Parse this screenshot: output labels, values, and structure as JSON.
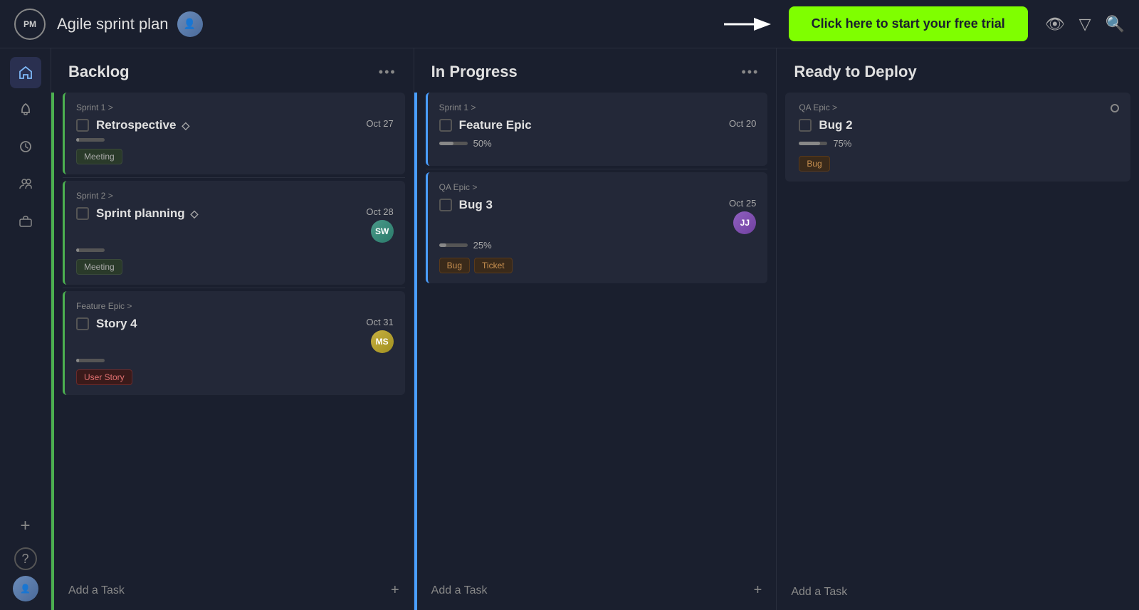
{
  "header": {
    "logo": "PM",
    "title": "Agile sprint plan",
    "free_trial_cta": "Click here to start your free trial"
  },
  "sidebar": {
    "items": [
      {
        "name": "home",
        "icon": "⌂",
        "active": true
      },
      {
        "name": "notifications",
        "icon": "🔔",
        "active": false
      },
      {
        "name": "history",
        "icon": "🕐",
        "active": false
      },
      {
        "name": "team",
        "icon": "👥",
        "active": false
      },
      {
        "name": "briefcase",
        "icon": "💼",
        "active": false
      }
    ],
    "bottom": [
      {
        "name": "add",
        "icon": "+"
      },
      {
        "name": "help",
        "icon": "?"
      }
    ]
  },
  "columns": [
    {
      "id": "backlog",
      "title": "Backlog",
      "accent": "green",
      "cards": [
        {
          "id": "card-retrospective",
          "parent": "Sprint 1 >",
          "title": "Retrospective",
          "has_diamond": true,
          "date": "Oct 27",
          "progress": null,
          "tags": [
            "Meeting"
          ],
          "avatar": null,
          "border": "green"
        },
        {
          "id": "card-sprint-planning",
          "parent": "Sprint 2 >",
          "title": "Sprint planning",
          "has_diamond": true,
          "date": "Oct 28",
          "progress": null,
          "tags": [
            "Meeting"
          ],
          "avatar": "SW",
          "avatar_class": "avatar-sw",
          "border": "green"
        },
        {
          "id": "card-story4",
          "parent": "Feature Epic >",
          "title": "Story 4",
          "has_diamond": false,
          "date": "Oct 31",
          "progress": null,
          "tags": [
            "User Story"
          ],
          "avatar": "MS",
          "avatar_class": "avatar-ms",
          "border": "green"
        }
      ],
      "add_task_label": "Add a Task"
    },
    {
      "id": "in-progress",
      "title": "In Progress",
      "accent": "blue",
      "cards": [
        {
          "id": "card-feature-epic",
          "parent": "Sprint 1 >",
          "title": "Feature Epic",
          "has_diamond": false,
          "date": "Oct 20",
          "progress": 50,
          "progress_label": "50%",
          "tags": [],
          "avatar": null,
          "border": "blue"
        },
        {
          "id": "card-bug3",
          "parent": "QA Epic >",
          "title": "Bug 3",
          "has_diamond": false,
          "date": "Oct 25",
          "progress": 25,
          "progress_label": "25%",
          "tags": [
            "Bug",
            "Ticket"
          ],
          "avatar": "JJ",
          "avatar_class": "avatar-jj",
          "border": "blue"
        }
      ],
      "add_task_label": "Add a Task"
    },
    {
      "id": "ready-to-deploy",
      "title": "Ready to Deploy",
      "accent": "none",
      "cards": [
        {
          "id": "card-bug2",
          "parent": "QA Epic >",
          "title": "Bug 2",
          "has_diamond": false,
          "date": null,
          "progress": 75,
          "progress_label": "75%",
          "tags": [
            "Bug"
          ],
          "avatar": null,
          "border": "none"
        }
      ],
      "add_task_label": "Add a Task"
    }
  ]
}
